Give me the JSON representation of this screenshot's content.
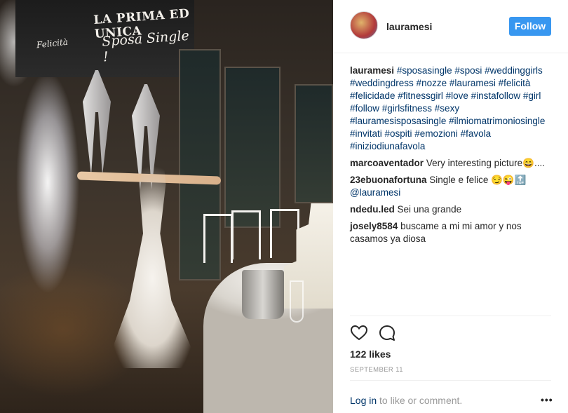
{
  "photo": {
    "banner_title": "LA PRIMA ED UNICA",
    "banner_subtitle": "Sposa Single !",
    "banner_script": "Felicità"
  },
  "header": {
    "username": "lauramesi",
    "follow_label": "Follow"
  },
  "caption": {
    "author": "lauramesi",
    "text": "#sposasingle #sposi #weddinggirls #weddingdress #nozze #lauramesi #felicità #felicidade #fitnessgirl #love #instafollow #girl #follow #girlsfitness #sexy #lauramesisposasingle #ilmiomatrimoniosingle #invitati #ospiti #emozioni #favola #iniziodiunafavola"
  },
  "comments": [
    {
      "author": "marcoaventador",
      "text": "Very interesting picture😄...."
    },
    {
      "author": "23ebuonafortuna",
      "text": "Single e felice 😏😜🔝",
      "mention": "@lauramesi"
    },
    {
      "author": "ndedu.led",
      "text": "Sei una grande"
    },
    {
      "author": "josely8584",
      "text": "buscame a mi mi amor y nos casamos ya diosa"
    }
  ],
  "icons": {
    "like": "heart-icon",
    "comment": "comment-bubble-icon",
    "more": "more-options-icon"
  },
  "likes_label": "122 likes",
  "date_label": "SEPTEMBER 11",
  "footer": {
    "login_link": "Log in",
    "login_text": " to like or comment.",
    "more_label": "•••"
  },
  "colors": {
    "follow_button": "#3897f0",
    "link": "#003569",
    "muted": "#999999"
  }
}
